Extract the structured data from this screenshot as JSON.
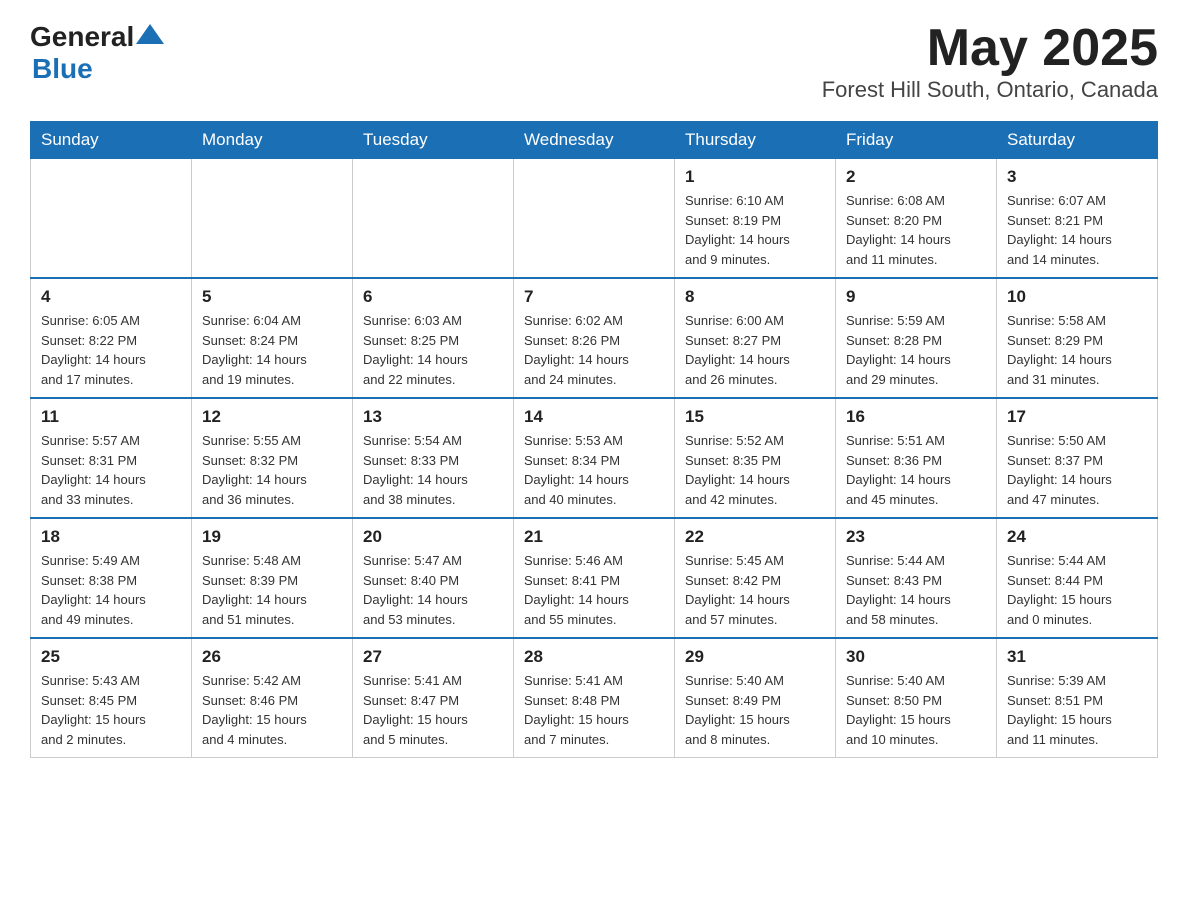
{
  "header": {
    "logo_general": "General",
    "logo_blue": "Blue",
    "title": "May 2025",
    "location": "Forest Hill South, Ontario, Canada"
  },
  "weekdays": [
    "Sunday",
    "Monday",
    "Tuesday",
    "Wednesday",
    "Thursday",
    "Friday",
    "Saturday"
  ],
  "weeks": [
    [
      {
        "day": "",
        "info": ""
      },
      {
        "day": "",
        "info": ""
      },
      {
        "day": "",
        "info": ""
      },
      {
        "day": "",
        "info": ""
      },
      {
        "day": "1",
        "info": "Sunrise: 6:10 AM\nSunset: 8:19 PM\nDaylight: 14 hours\nand 9 minutes."
      },
      {
        "day": "2",
        "info": "Sunrise: 6:08 AM\nSunset: 8:20 PM\nDaylight: 14 hours\nand 11 minutes."
      },
      {
        "day": "3",
        "info": "Sunrise: 6:07 AM\nSunset: 8:21 PM\nDaylight: 14 hours\nand 14 minutes."
      }
    ],
    [
      {
        "day": "4",
        "info": "Sunrise: 6:05 AM\nSunset: 8:22 PM\nDaylight: 14 hours\nand 17 minutes."
      },
      {
        "day": "5",
        "info": "Sunrise: 6:04 AM\nSunset: 8:24 PM\nDaylight: 14 hours\nand 19 minutes."
      },
      {
        "day": "6",
        "info": "Sunrise: 6:03 AM\nSunset: 8:25 PM\nDaylight: 14 hours\nand 22 minutes."
      },
      {
        "day": "7",
        "info": "Sunrise: 6:02 AM\nSunset: 8:26 PM\nDaylight: 14 hours\nand 24 minutes."
      },
      {
        "day": "8",
        "info": "Sunrise: 6:00 AM\nSunset: 8:27 PM\nDaylight: 14 hours\nand 26 minutes."
      },
      {
        "day": "9",
        "info": "Sunrise: 5:59 AM\nSunset: 8:28 PM\nDaylight: 14 hours\nand 29 minutes."
      },
      {
        "day": "10",
        "info": "Sunrise: 5:58 AM\nSunset: 8:29 PM\nDaylight: 14 hours\nand 31 minutes."
      }
    ],
    [
      {
        "day": "11",
        "info": "Sunrise: 5:57 AM\nSunset: 8:31 PM\nDaylight: 14 hours\nand 33 minutes."
      },
      {
        "day": "12",
        "info": "Sunrise: 5:55 AM\nSunset: 8:32 PM\nDaylight: 14 hours\nand 36 minutes."
      },
      {
        "day": "13",
        "info": "Sunrise: 5:54 AM\nSunset: 8:33 PM\nDaylight: 14 hours\nand 38 minutes."
      },
      {
        "day": "14",
        "info": "Sunrise: 5:53 AM\nSunset: 8:34 PM\nDaylight: 14 hours\nand 40 minutes."
      },
      {
        "day": "15",
        "info": "Sunrise: 5:52 AM\nSunset: 8:35 PM\nDaylight: 14 hours\nand 42 minutes."
      },
      {
        "day": "16",
        "info": "Sunrise: 5:51 AM\nSunset: 8:36 PM\nDaylight: 14 hours\nand 45 minutes."
      },
      {
        "day": "17",
        "info": "Sunrise: 5:50 AM\nSunset: 8:37 PM\nDaylight: 14 hours\nand 47 minutes."
      }
    ],
    [
      {
        "day": "18",
        "info": "Sunrise: 5:49 AM\nSunset: 8:38 PM\nDaylight: 14 hours\nand 49 minutes."
      },
      {
        "day": "19",
        "info": "Sunrise: 5:48 AM\nSunset: 8:39 PM\nDaylight: 14 hours\nand 51 minutes."
      },
      {
        "day": "20",
        "info": "Sunrise: 5:47 AM\nSunset: 8:40 PM\nDaylight: 14 hours\nand 53 minutes."
      },
      {
        "day": "21",
        "info": "Sunrise: 5:46 AM\nSunset: 8:41 PM\nDaylight: 14 hours\nand 55 minutes."
      },
      {
        "day": "22",
        "info": "Sunrise: 5:45 AM\nSunset: 8:42 PM\nDaylight: 14 hours\nand 57 minutes."
      },
      {
        "day": "23",
        "info": "Sunrise: 5:44 AM\nSunset: 8:43 PM\nDaylight: 14 hours\nand 58 minutes."
      },
      {
        "day": "24",
        "info": "Sunrise: 5:44 AM\nSunset: 8:44 PM\nDaylight: 15 hours\nand 0 minutes."
      }
    ],
    [
      {
        "day": "25",
        "info": "Sunrise: 5:43 AM\nSunset: 8:45 PM\nDaylight: 15 hours\nand 2 minutes."
      },
      {
        "day": "26",
        "info": "Sunrise: 5:42 AM\nSunset: 8:46 PM\nDaylight: 15 hours\nand 4 minutes."
      },
      {
        "day": "27",
        "info": "Sunrise: 5:41 AM\nSunset: 8:47 PM\nDaylight: 15 hours\nand 5 minutes."
      },
      {
        "day": "28",
        "info": "Sunrise: 5:41 AM\nSunset: 8:48 PM\nDaylight: 15 hours\nand 7 minutes."
      },
      {
        "day": "29",
        "info": "Sunrise: 5:40 AM\nSunset: 8:49 PM\nDaylight: 15 hours\nand 8 minutes."
      },
      {
        "day": "30",
        "info": "Sunrise: 5:40 AM\nSunset: 8:50 PM\nDaylight: 15 hours\nand 10 minutes."
      },
      {
        "day": "31",
        "info": "Sunrise: 5:39 AM\nSunset: 8:51 PM\nDaylight: 15 hours\nand 11 minutes."
      }
    ]
  ]
}
